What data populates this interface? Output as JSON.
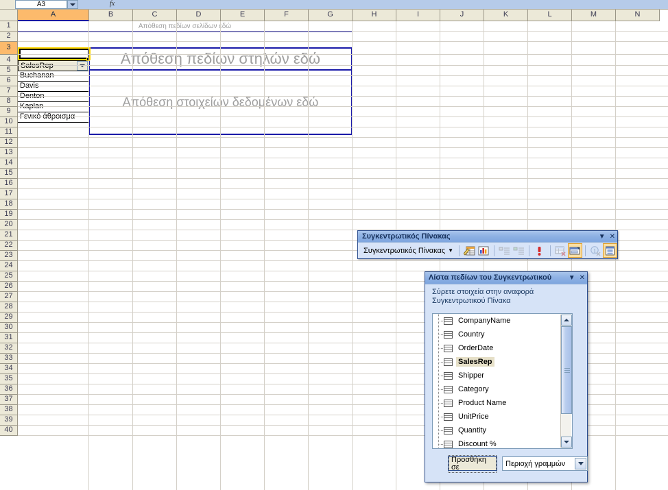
{
  "formula_bar": {
    "name_box_value": "A3",
    "fx_label": "fx",
    "dropdown_icon": "chevron-down-icon"
  },
  "grid": {
    "columns": [
      "A",
      "B",
      "C",
      "D",
      "E",
      "F",
      "G",
      "H",
      "I",
      "J",
      "K",
      "L",
      "M",
      "N"
    ],
    "active_column": "A",
    "rows": [
      1,
      2,
      3,
      4,
      5,
      6,
      7,
      8,
      9,
      10,
      11,
      12,
      13,
      14,
      15,
      16,
      17,
      18,
      19,
      20,
      21,
      22,
      23,
      24,
      25,
      26,
      27,
      28,
      29,
      30,
      31,
      32,
      33,
      34,
      35,
      36,
      37,
      38,
      39,
      40
    ],
    "active_row": 3
  },
  "pivot": {
    "page_zone_label": "Απόθεση πεδίων σελίδων εδώ",
    "column_zone_label": "Απόθεση πεδίων στηλών εδώ",
    "data_zone_label": "Απόθεση στοιχείων δεδομένων εδώ",
    "row_field_header": "SalesRep",
    "row_field_dropdown_icon": "chevron-down-icon",
    "row_items": [
      "Buchanan",
      "Davis",
      "Denton",
      "Kaplan",
      "Γενικό άθροισμα"
    ]
  },
  "pivot_toolbar": {
    "title": "Συγκεντρωτικός Πίνακας",
    "collapse_icon": "chevron-down-icon",
    "close_icon": "close-icon",
    "menu_label": "Συγκεντρωτικός Πίνακας",
    "menu_accel": "Σ",
    "menu_arrow_icon": "chevron-down-icon",
    "buttons": [
      {
        "name": "format-report-icon",
        "label": "Μορφοποίηση αναφοράς",
        "state": "normal"
      },
      {
        "name": "chart-wizard-icon",
        "label": "Οδηγός γραφημάτων",
        "state": "normal"
      },
      {
        "name": "hide-detail-icon",
        "label": "Απόκρυψη λεπτομερειών",
        "state": "disabled"
      },
      {
        "name": "show-detail-icon",
        "label": "Εμφάνιση λεπτομερειών",
        "state": "disabled"
      },
      {
        "name": "refresh-data-icon",
        "label": "Ανανέωση δεδομένων",
        "state": "normal"
      },
      {
        "name": "include-hidden-items-icon",
        "label": "Συμπερίληψη κρυφών στοιχείων",
        "state": "disabled"
      },
      {
        "name": "field-settings-icon",
        "label": "Ρυθμίσεις πεδίου",
        "state": "pressed"
      },
      {
        "name": "hide-field-list-icon",
        "label": "Απόκρυψη πεδίων",
        "state": "disabled"
      },
      {
        "name": "show-field-list-icon",
        "label": "Εμφάνιση λίστας πεδίων",
        "state": "pressed"
      }
    ]
  },
  "field_list": {
    "title": "Λίστα πεδίων του Συγκεντρωτικού",
    "collapse_icon": "chevron-down-icon",
    "close_icon": "close-icon",
    "instruction": "Σύρετε στοιχεία στην αναφορά Συγκεντρωτικού Πίνακα",
    "fields": [
      {
        "label": "CompanyName",
        "selected": false
      },
      {
        "label": "Country",
        "selected": false
      },
      {
        "label": "OrderDate",
        "selected": false
      },
      {
        "label": "SalesRep",
        "selected": true
      },
      {
        "label": "Shipper",
        "selected": false
      },
      {
        "label": "Category",
        "selected": false
      },
      {
        "label": "Product Name",
        "selected": false
      },
      {
        "label": "UnitPrice",
        "selected": false
      },
      {
        "label": "Quantity",
        "selected": false
      },
      {
        "label": "Discount %",
        "selected": false
      }
    ],
    "add_to_button": "Προσθήκη σε",
    "area_select_value": "Περιοχή γραμμών",
    "area_select_arrow_icon": "chevron-down-icon",
    "scroll_up_icon": "scroll-up-arrow-icon",
    "scroll_down_icon": "scroll-down-arrow-icon"
  },
  "colors": {
    "active_header": "#fcba6c",
    "pivot_border": "#1a1aa8",
    "dialog_title": "#8fb2e4",
    "selection_highlight": "#e6e0c8"
  }
}
